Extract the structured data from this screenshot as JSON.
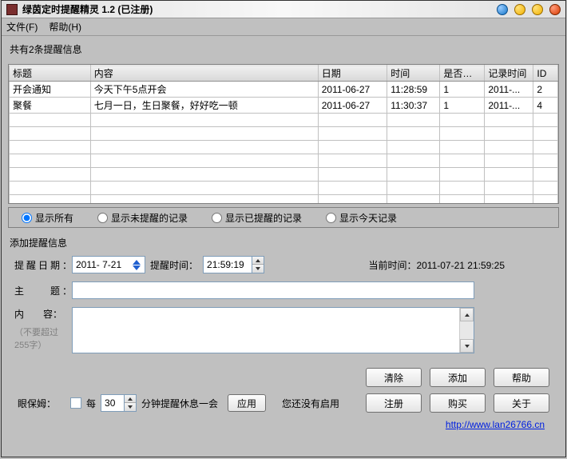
{
  "window": {
    "title": "绿茵定时提醒精灵 1.2 (已注册)"
  },
  "menu": {
    "file": "文件(F)",
    "help": "帮助(H)"
  },
  "listinfo": "共有2条提醒信息",
  "columns": {
    "title": "标题",
    "content": "内容",
    "date": "日期",
    "time": "时间",
    "valid": "是否生效",
    "rectime": "记录时间",
    "id": "ID"
  },
  "rows": [
    {
      "title": "开会通知",
      "content": "今天下午5点开会",
      "date": "2011-06-27",
      "time": "11:28:59",
      "valid": "1",
      "rectime": "2011-...",
      "id": "2"
    },
    {
      "title": "聚餐",
      "content": "七月一日，生日聚餐，好好吃一顿",
      "date": "2011-06-27",
      "time": "11:30:37",
      "valid": "1",
      "rectime": "2011-...",
      "id": "4"
    }
  ],
  "filters": {
    "all": "显示所有",
    "unremind": "显示未提醒的记录",
    "reminded": "显示已提醒的记录",
    "today": "显示今天记录"
  },
  "addlabel": "添加提醒信息",
  "form": {
    "datelabel": "提醒日期",
    "date": "2011- 7-21",
    "timelabel": "提醒时间：",
    "time": "21:59:19",
    "curtimelabel": "当前时间：",
    "curtime": "2011-07-21 21:59:25",
    "subjectlabel": "主　　题",
    "subject": "",
    "contentlabel": "内　　容",
    "content": "",
    "contentnote": "（不要超过255字）"
  },
  "buttons": {
    "clear": "清除",
    "add": "添加",
    "help": "帮助",
    "register": "注册",
    "buy": "购买",
    "about": "关于",
    "apply": "应用"
  },
  "eye": {
    "label": "眼保姆：",
    "every": "每",
    "num": "30",
    "text": "分钟提醒休息一会",
    "status": "您还没有启用"
  },
  "link": {
    "text": "http://www.lan26766.cn"
  }
}
